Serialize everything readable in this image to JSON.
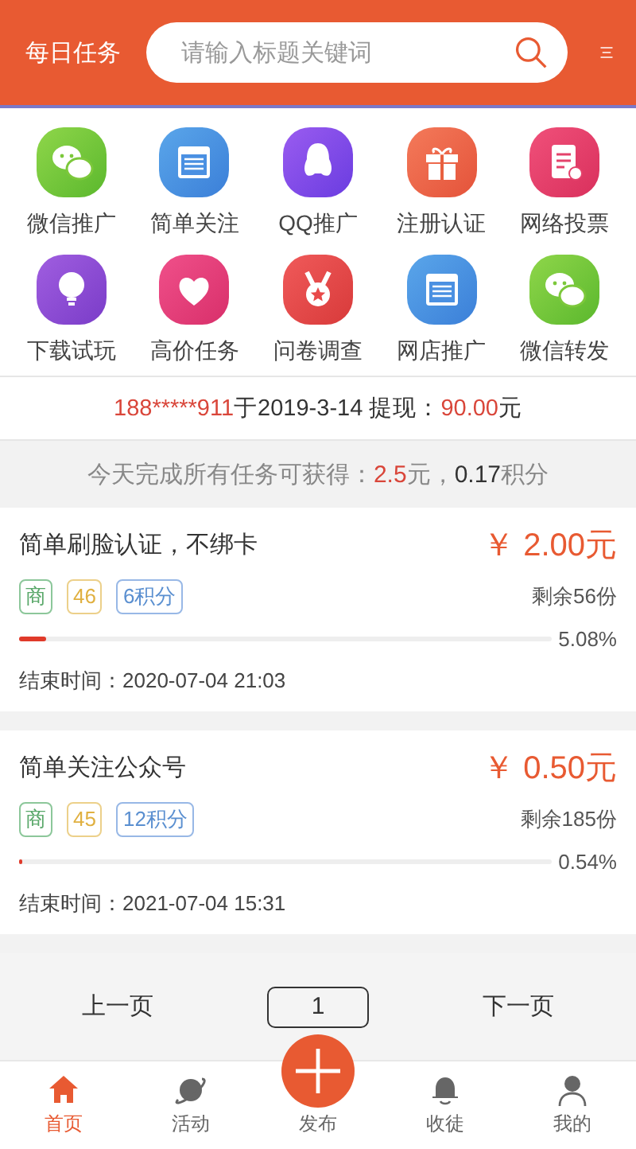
{
  "header": {
    "title": "每日任务",
    "search": {
      "placeholder": "请输入标题关键词"
    }
  },
  "categories": [
    {
      "label": "微信推广",
      "kind": "chat"
    },
    {
      "label": "简单关注",
      "kind": "page"
    },
    {
      "label": "QQ推广",
      "kind": "penguin"
    },
    {
      "label": "注册认证",
      "kind": "gift"
    },
    {
      "label": "网络投票",
      "kind": "clipboard"
    },
    {
      "label": "下载试玩",
      "kind": "bulb"
    },
    {
      "label": "高价任务",
      "kind": "heart"
    },
    {
      "label": "问卷调查",
      "kind": "medal"
    },
    {
      "label": "网店推广",
      "kind": "page"
    },
    {
      "label": "微信转发",
      "kind": "chat"
    }
  ],
  "notice": {
    "user": "188*****911",
    "date": "于2019-3-14 提现：",
    "amount": "90.00",
    "unit": "元"
  },
  "summary": {
    "prefix": "今天完成所有任务可获得：",
    "money": "2.5",
    "money_unit": "元，",
    "points": "0.17",
    "points_unit": "积分"
  },
  "tasks": [
    {
      "title": "简单刷脸认证，不绑卡",
      "price": "￥ 2.00元",
      "tags": [
        "商",
        "46",
        "6积分"
      ],
      "remaining": "剩余56份",
      "level": 0.0508,
      "percent": "5.08%",
      "end_time": "结束时间：2020-07-04 21:03"
    },
    {
      "title": "简单关注公众号",
      "price": "￥ 0.50元",
      "tags": [
        "商",
        "45",
        "12积分"
      ],
      "remaining": "剩余185份",
      "level": 0.0054,
      "percent": "0.54%",
      "end_time": "结束时间：2021-07-04 15:31"
    }
  ],
  "pager": {
    "prev": "上一页",
    "page": "1",
    "next": "下一页"
  },
  "tab_bar": [
    {
      "label": "首页",
      "kind": "home",
      "selected": true
    },
    {
      "label": "活动",
      "kind": "planet",
      "selected": false
    },
    {
      "label": "发布",
      "kind": "publish",
      "selected": false
    },
    {
      "label": "收徒",
      "kind": "bell",
      "selected": false
    },
    {
      "label": "我的",
      "kind": "person",
      "selected": false
    }
  ]
}
